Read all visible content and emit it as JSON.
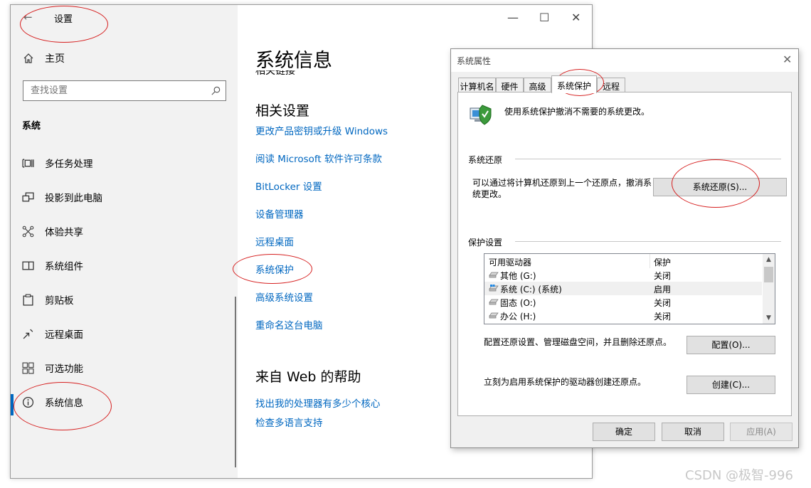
{
  "settings": {
    "title": "设置",
    "home_label": "主页",
    "search_placeholder": "查找设置",
    "section_label": "系统",
    "nav_items": [
      {
        "label": "多任务处理",
        "icon": "multitask-icon"
      },
      {
        "label": "投影到此电脑",
        "icon": "project-icon"
      },
      {
        "label": "体验共享",
        "icon": "share-icon"
      },
      {
        "label": "系统组件",
        "icon": "components-icon"
      },
      {
        "label": "剪贴板",
        "icon": "clipboard-icon"
      },
      {
        "label": "远程桌面",
        "icon": "remote-desktop-icon"
      },
      {
        "label": "可选功能",
        "icon": "optional-features-icon"
      },
      {
        "label": "系统信息",
        "icon": "info-icon"
      }
    ],
    "content": {
      "page_title": "系统信息",
      "clipped_heading": "相关链接",
      "related_heading": "相关设置",
      "related_links": [
        "更改产品密钥或升级 Windows",
        "阅读 Microsoft 软件许可条款",
        "BitLocker 设置",
        "设备管理器",
        "远程桌面",
        "系统保护",
        "高级系统设置",
        "重命名这台电脑"
      ],
      "web_heading": "来自 Web 的帮助",
      "web_links": [
        "找出我的处理器有多少个核心",
        "检查多语言支持"
      ]
    }
  },
  "dialog": {
    "title": "系统属性",
    "tabs": [
      "计算机名",
      "硬件",
      "高级",
      "系统保护",
      "远程"
    ],
    "active_tab": "系统保护",
    "intro_text": "使用系统保护撤消不需要的系统更改。",
    "restore_group": "系统还原",
    "restore_desc_1": "可以通过将计算机还原到上一个还原点，撤消系",
    "restore_desc_2": "统更改。",
    "restore_button": "系统还原(S)...",
    "protection_group": "保护设置",
    "drives_header": [
      "可用驱动器",
      "保护"
    ],
    "drives": [
      {
        "name": "其他 (G:)",
        "protection": "关闭"
      },
      {
        "name": "系统 (C:) (系统)",
        "protection": "启用"
      },
      {
        "name": "固态 (O:)",
        "protection": "关闭"
      },
      {
        "name": "办公 (H:)",
        "protection": "关闭"
      }
    ],
    "configure_desc": "配置还原设置、管理磁盘空间，并且删除还原点。",
    "configure_button": "配置(O)...",
    "create_desc": "立刻为启用系统保护的驱动器创建还原点。",
    "create_button": "创建(C)...",
    "ok_button": "确定",
    "cancel_button": "取消",
    "apply_button": "应用(A)"
  },
  "watermark": "CSDN @极智-996",
  "colors": {
    "link": "#0067c0",
    "annotation": "#d62020",
    "sidebar_bg": "#f2f2f2",
    "dialog_bg": "#f0f0f0"
  }
}
